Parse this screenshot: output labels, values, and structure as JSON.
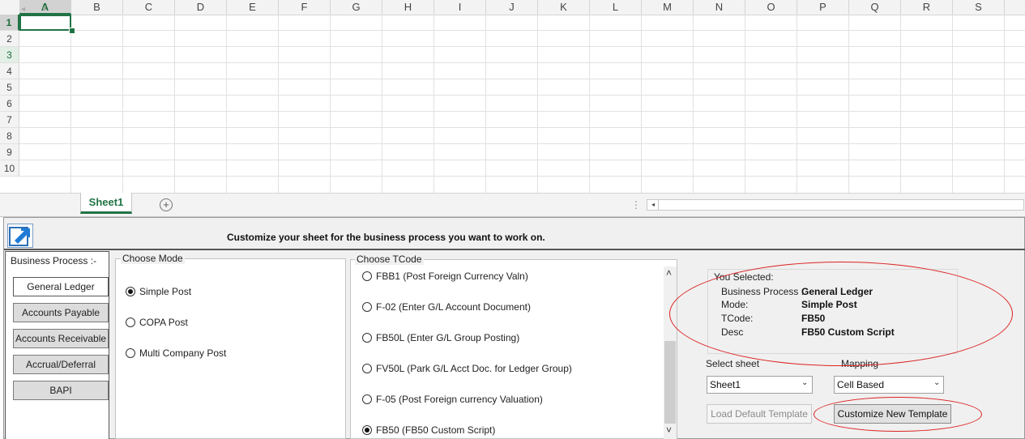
{
  "spreadsheet": {
    "columns": [
      "A",
      "B",
      "C",
      "D",
      "E",
      "F",
      "G",
      "H",
      "I",
      "J",
      "K",
      "L",
      "M",
      "N",
      "O",
      "P",
      "Q",
      "R",
      "S"
    ],
    "rows": [
      "1",
      "2",
      "3",
      "4",
      "5",
      "6",
      "7",
      "8",
      "9",
      "10"
    ],
    "sheet_tab": "Sheet1",
    "add_sheet_symbol": "+",
    "nav_prev": "◂",
    "nav_next": "▸",
    "dots": "⋮",
    "scroll_left": "◂"
  },
  "pane": {
    "title": "Customize your sheet for the business process you want to work on.",
    "business_process": {
      "label": "Business Process :-",
      "buttons": [
        "General Ledger",
        "Accounts Payable",
        "Accounts Receivable",
        "Accrual/Deferral",
        "BAPI"
      ]
    },
    "choose_mode": {
      "label": "Choose Mode",
      "options": [
        "Simple Post",
        "COPA Post",
        "Multi Company Post"
      ],
      "selected": "Simple Post"
    },
    "choose_tcode": {
      "label": "Choose TCode",
      "options": [
        "FBB1 (Post Foreign Currency Valn)",
        "F-02 (Enter G/L Account Document)",
        "FB50L (Enter G/L Group Posting)",
        "FV50L (Park G/L Acct Doc. for Ledger Group)",
        "F-05 (Post Foreign currency Valuation)",
        "FB50 (FB50 Custom Script)"
      ],
      "selected": "FB50 (FB50 Custom Script)",
      "scroll_up": "˄",
      "scroll_down": "˅"
    },
    "you_selected": {
      "heading": "You Selected:",
      "business_process_label": "Business Process :",
      "business_process_value": "General Ledger",
      "mode_label": "Mode:",
      "mode_value": "Simple Post",
      "tcode_label": "TCode:",
      "tcode_value": "FB50",
      "desc_label": "Desc",
      "desc_value": "FB50 Custom Script"
    },
    "select_sheet": {
      "label": "Select sheet",
      "value": "Sheet1"
    },
    "mapping": {
      "label": "Mapping",
      "value": "Cell Based"
    },
    "load_default_label": "Load Default Template",
    "customize_new_label": "Customize New Template",
    "dropdown_arrow": "⌄"
  },
  "colors": {
    "excel_green": "#217346",
    "annotation_red": "#d22222"
  }
}
